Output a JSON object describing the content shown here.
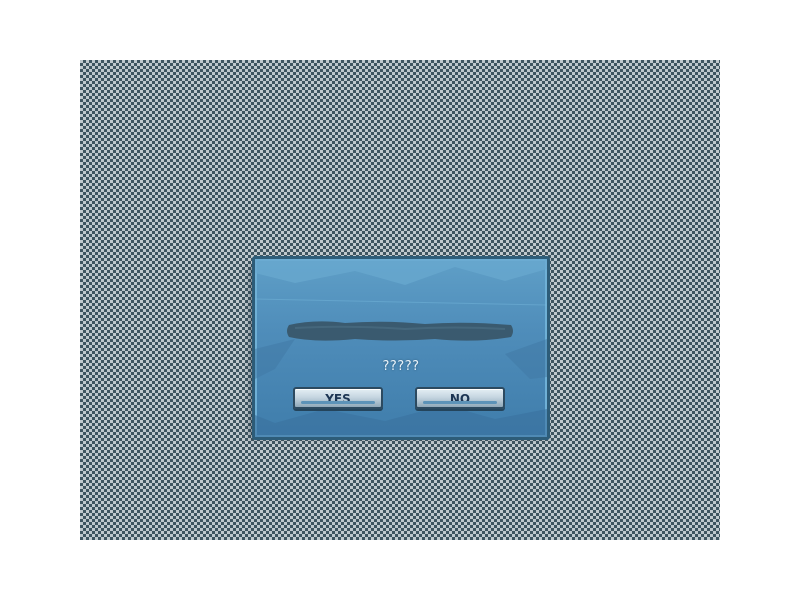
{
  "dialog": {
    "message": "?????",
    "buttons": {
      "yes_label": "YES",
      "no_label": "NO"
    }
  },
  "colors": {
    "dialog_fill": "#4f8dba",
    "dialog_border": "#2d5c78",
    "title_bar": "#3a5a6f",
    "button_face": "#c6d6e1",
    "button_text": "#1c3553"
  }
}
